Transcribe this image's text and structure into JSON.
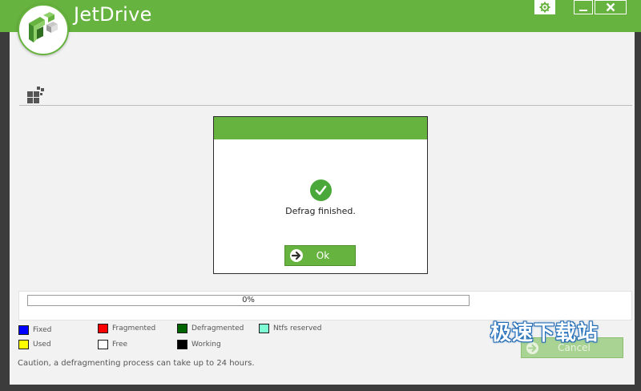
{
  "app": {
    "title": "JetDrive"
  },
  "dialog": {
    "message": "Defrag finished.",
    "ok_label": "Ok"
  },
  "progress": {
    "text": "0%",
    "value": 0
  },
  "legend": [
    {
      "label": "Fixed",
      "color": "#0000ff"
    },
    {
      "label": "Fragmented",
      "color": "#ff0000"
    },
    {
      "label": "Defragmented",
      "color": "#006400"
    },
    {
      "label": "Ntfs reserved",
      "color": "#7fffd4"
    },
    {
      "label": "Used",
      "color": "#ffff00"
    },
    {
      "label": "Free",
      "color": "#ffffff"
    },
    {
      "label": "Working",
      "color": "#000000"
    }
  ],
  "caution": "Caution, a defragmenting process can take up to 24 hours.",
  "cancel_label": "Cancel",
  "watermark": "极速下载站",
  "colors": {
    "accent": "#67b33f",
    "border": "#3c3c3c"
  }
}
